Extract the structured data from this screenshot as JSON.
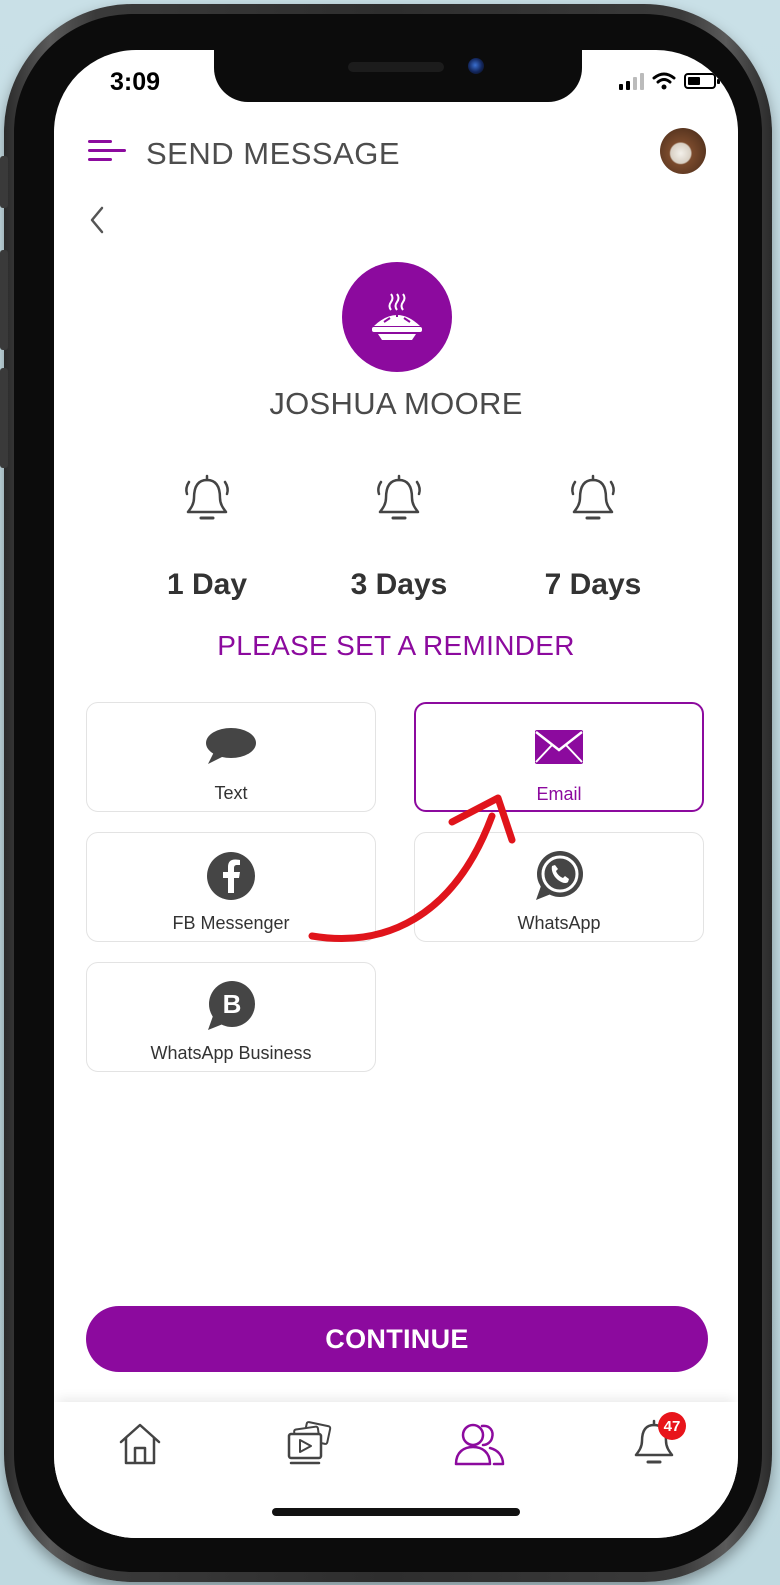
{
  "status_bar": {
    "time": "3:09"
  },
  "header": {
    "title": "SEND MESSAGE",
    "menu_icon": "menu-icon",
    "avatar_icon": "user-avatar"
  },
  "contact": {
    "name": "JOSHUA MOORE",
    "icon": "pie-icon",
    "color": "#8c0a9e"
  },
  "reminders": [
    {
      "label": "1 Day",
      "icon": "bell-icon"
    },
    {
      "label": "3 Days",
      "icon": "bell-icon"
    },
    {
      "label": "7 Days",
      "icon": "bell-icon"
    }
  ],
  "reminder_prompt": "PLEASE SET A REMINDER",
  "channels": [
    {
      "label": "Text",
      "icon": "chat-bubble-icon",
      "selected": false
    },
    {
      "label": "Email",
      "icon": "envelope-icon",
      "selected": true
    },
    {
      "label": "FB Messenger",
      "icon": "facebook-icon",
      "selected": false
    },
    {
      "label": "WhatsApp",
      "icon": "whatsapp-icon",
      "selected": false
    },
    {
      "label": "WhatsApp Business",
      "icon": "whatsapp-business-icon",
      "selected": false
    }
  ],
  "continue_label": "CONTINUE",
  "nav": {
    "items": [
      {
        "icon": "home-icon",
        "active": false
      },
      {
        "icon": "media-icon",
        "active": false
      },
      {
        "icon": "contacts-icon",
        "active": true
      },
      {
        "icon": "notifications-icon",
        "active": false
      }
    ],
    "notification_badge": "47"
  },
  "colors": {
    "accent": "#8c0a9e",
    "annotation_arrow": "#e0141b",
    "badge": "#e8141b"
  }
}
